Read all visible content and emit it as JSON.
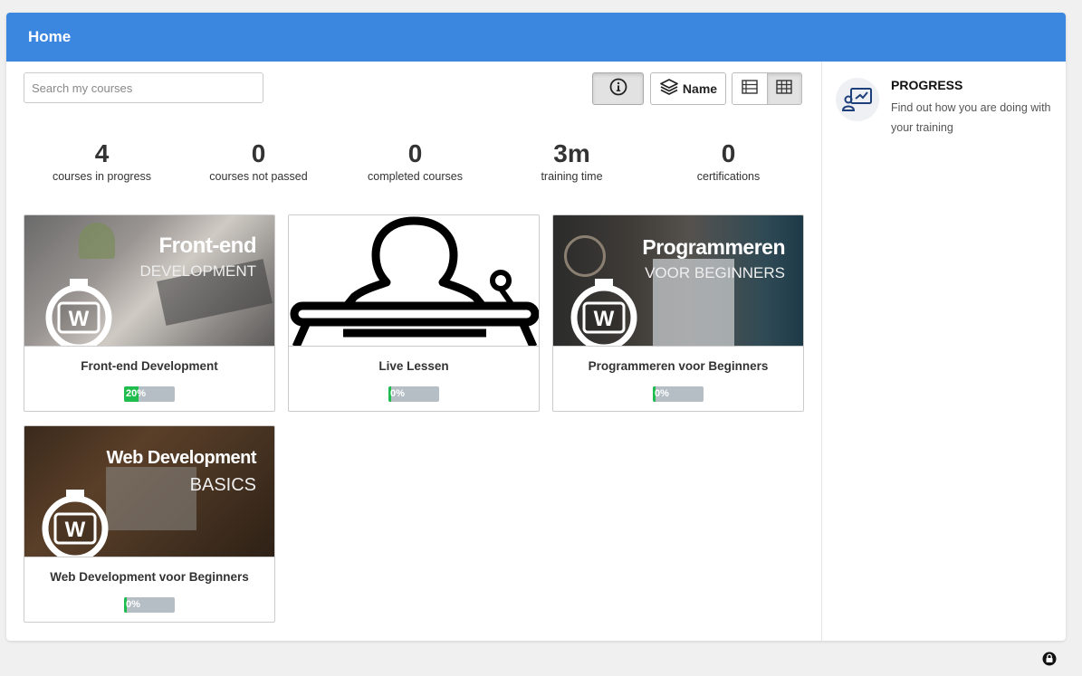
{
  "header": {
    "title": "Home"
  },
  "search": {
    "placeholder": "Search my courses",
    "value": ""
  },
  "toolbar": {
    "sort_label": "Name",
    "view_active": "grid"
  },
  "stats": [
    {
      "value": "4",
      "label": "courses in progress"
    },
    {
      "value": "0",
      "label": "courses not passed"
    },
    {
      "value": "0",
      "label": "completed courses"
    },
    {
      "value": "3m",
      "label": "training time"
    },
    {
      "value": "0",
      "label": "certifications"
    }
  ],
  "courses": [
    {
      "name": "Front-end Development",
      "progress_label": "20%",
      "progress": 0.2,
      "thumb_title": "Front-end",
      "thumb_subtitle": "DEVELOPMENT"
    },
    {
      "name": "Live Lessen",
      "progress_label": "0%",
      "progress": 0.0
    },
    {
      "name": "Programmeren voor Beginners",
      "progress_label": "0%",
      "progress": 0.0,
      "thumb_title": "Programmeren",
      "thumb_subtitle": "VOOR BEGINNERS"
    },
    {
      "name": "Web Development voor Beginners",
      "progress_label": "0%",
      "progress": 0.0,
      "thumb_title": "Web Development",
      "thumb_subtitle": "BASICS"
    }
  ],
  "sidebar": {
    "progress_title": "PROGRESS",
    "progress_description": "Find out how you are doing with your training"
  },
  "icons": [
    "info-icon",
    "layers-icon",
    "list-view-icon",
    "grid-view-icon",
    "progress-chart-icon",
    "lock-icon"
  ],
  "colors": {
    "header": "#3b87e0",
    "progress_fill": "#1fbd4d",
    "progress_track": "#b5bec5"
  }
}
